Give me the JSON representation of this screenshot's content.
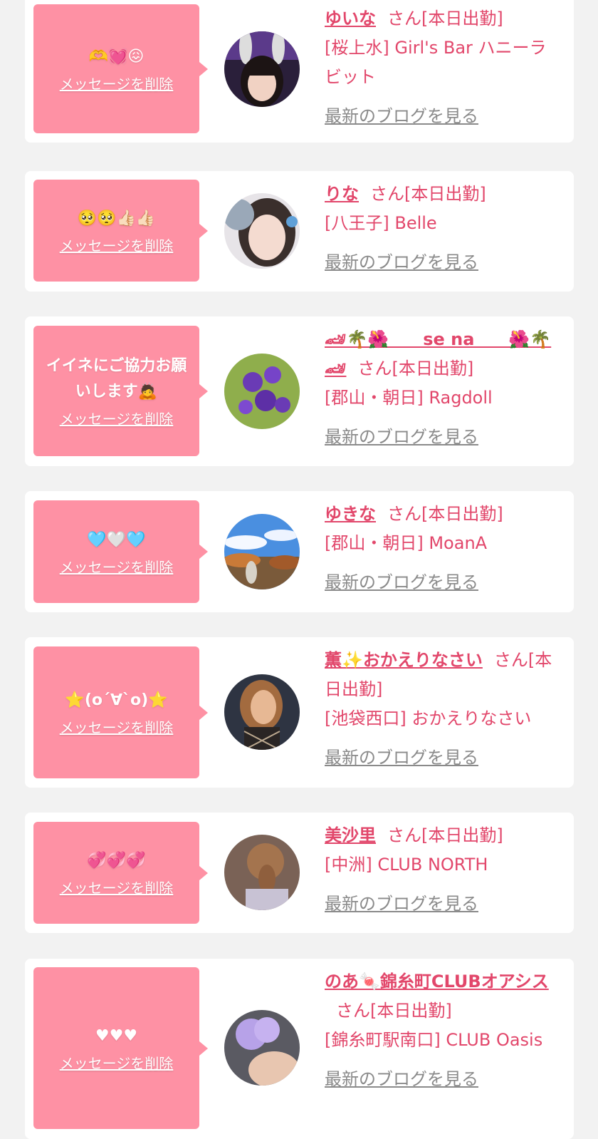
{
  "delete_label": "メッセージを削除",
  "blog_label": "最新のブログを見る",
  "san_label": "さん",
  "status_label": "[本日出勤]",
  "cards": [
    {
      "message": "🫶💓😖",
      "name": "ゆいな",
      "shop": "[桜上水] Girl's Bar ハニーラビット",
      "avatar_icon": "girl-bunny-ears-photo"
    },
    {
      "message": "🥺🥺👍🏻👍🏻",
      "name": "りな",
      "shop": "[八王子] Belle",
      "avatar_icon": "girl-selfie-photo"
    },
    {
      "message": "イイネにご協力お願いします🙇",
      "name": "🏎🌴🌺　　se na　　🌺🌴🏎",
      "shop": "[郡山・朝日] Ragdoll",
      "avatar_icon": "purple-flowers-photo"
    },
    {
      "message": "🩵🤍🩵",
      "name": "ゆきな",
      "shop": "[郡山・朝日] MoanA",
      "avatar_icon": "garden-sky-photo"
    },
    {
      "message": "⭐(o´∀`o)⭐",
      "name": "薫✨おかえりなさい",
      "shop": "[池袋西口] おかえりなさい",
      "avatar_icon": "woman-portrait-photo"
    },
    {
      "message": "💞💞💞",
      "name": "美沙里",
      "shop": "[中洲] CLUB NORTH",
      "avatar_icon": "woman-hair-back-photo"
    },
    {
      "message": "♥♥♥",
      "name": "のあ🍬錦糸町CLUBオアシス",
      "shop": "[錦糸町駅南口] CLUB Oasis",
      "avatar_icon": "blurred-flower-photo"
    }
  ],
  "colors": {
    "accent_pink": "#e2476b",
    "bubble_pink": "#fe91a4",
    "link_gray": "#8a8a8a",
    "background": "#f2f2f2"
  }
}
